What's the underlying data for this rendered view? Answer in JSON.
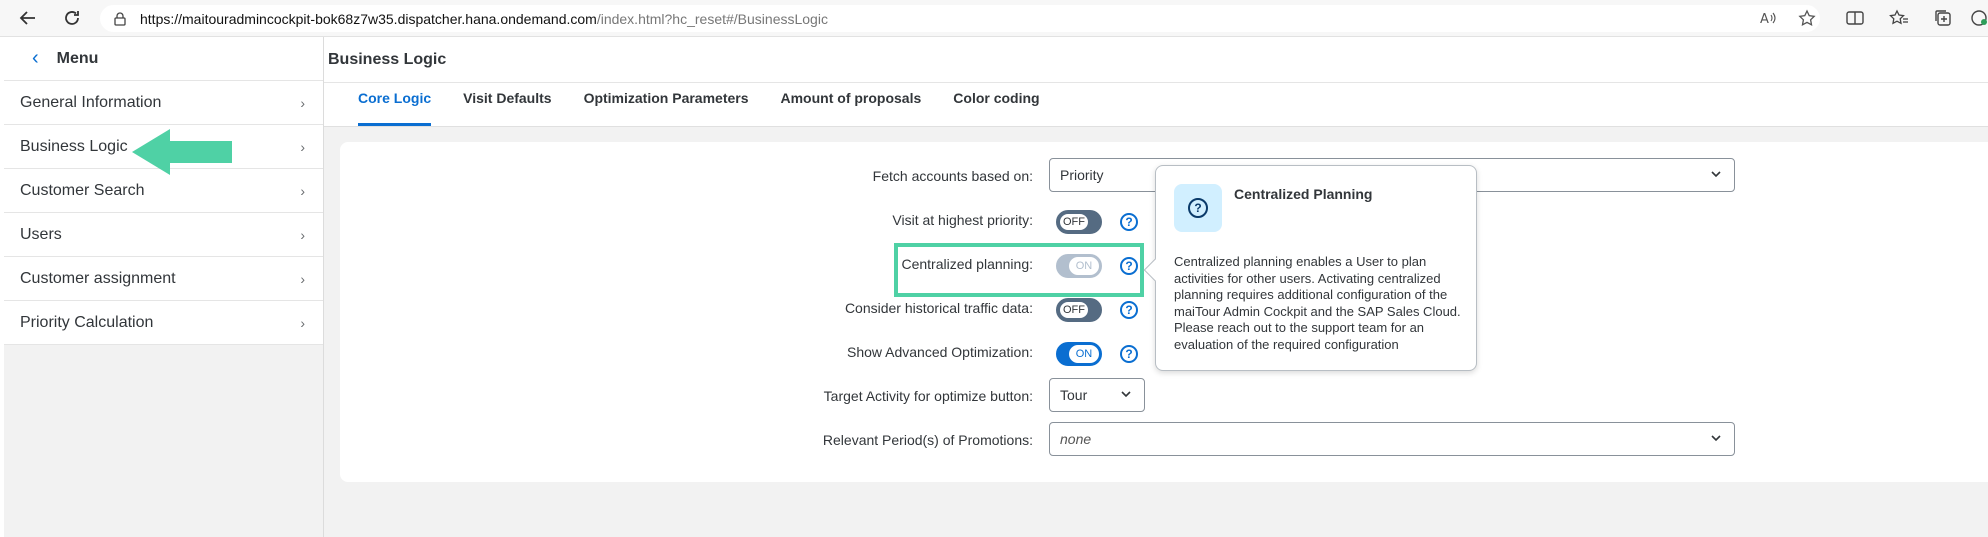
{
  "browser": {
    "url_host": "https://maitouradmincockpit-bok68z7w35.dispatcher.hana.ondemand.com",
    "url_rest": "/index.html?hc_reset#/BusinessLogic"
  },
  "sidebar": {
    "title": "Menu",
    "items": [
      {
        "label": "General Information"
      },
      {
        "label": "Business Logic"
      },
      {
        "label": "Customer Search"
      },
      {
        "label": "Users"
      },
      {
        "label": "Customer assignment"
      },
      {
        "label": "Priority Calculation"
      }
    ]
  },
  "main": {
    "title": "Business Logic",
    "tabs": [
      {
        "label": "Core Logic",
        "active": true
      },
      {
        "label": "Visit Defaults"
      },
      {
        "label": "Optimization Parameters"
      },
      {
        "label": "Amount of proposals"
      },
      {
        "label": "Color coding"
      }
    ],
    "form": {
      "fetch_label": "Fetch accounts based on:",
      "fetch_value": "Priority",
      "visit_label": "Visit at highest priority:",
      "visit_state": "OFF",
      "central_label": "Centralized planning:",
      "central_state": "ON",
      "traffic_label": "Consider historical traffic data:",
      "traffic_state": "OFF",
      "advanced_label": "Show Advanced Optimization:",
      "advanced_state": "ON",
      "target_label": "Target Activity for optimize button:",
      "target_value": "Tour",
      "promo_label": "Relevant Period(s) of Promotions:",
      "promo_value": "none"
    }
  },
  "popover": {
    "title": "Centralized Planning",
    "body": "Centralized planning enables a User to plan activities for other users. Activating centralized planning requires additional configuration of the maiTour Admin Cockpit and the SAP Sales Cloud. Please reach out to the support team for an evaluation of the required configuration"
  },
  "colors": {
    "accent": "#0a6ed1",
    "annotation": "#4fd1a5"
  }
}
